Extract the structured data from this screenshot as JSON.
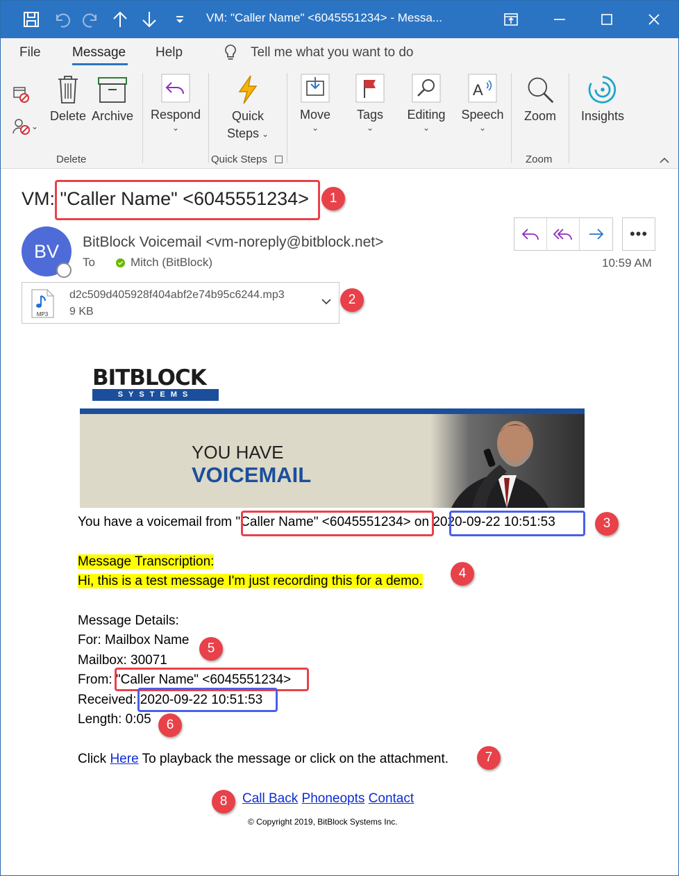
{
  "window": {
    "title": "VM: \"Caller Name\" <6045551234>  -  Messa...",
    "accent": "#2b74c3"
  },
  "tabs": [
    {
      "label": "File"
    },
    {
      "label": "Message"
    },
    {
      "label": "Help"
    }
  ],
  "tellme": {
    "label": "Tell me what you want to do"
  },
  "ribbon": {
    "delete_label": "Delete",
    "archive_label": "Archive",
    "delete_group": "Delete",
    "respond_label": "Respond",
    "quick_steps_line1": "Quick",
    "quick_steps_line2": "Steps",
    "quick_steps_group": "Quick Steps",
    "move_label": "Move",
    "tags_label": "Tags",
    "editing_label": "Editing",
    "speech_label": "Speech",
    "zoom_label": "Zoom",
    "zoom_group": "Zoom",
    "insights_label": "Insights"
  },
  "message": {
    "subject_prefix": "VM: ",
    "subject_caller": "\"Caller Name\" <6045551234>",
    "avatar_initials": "BV",
    "sender": "BitBlock Voicemail <vm-noreply@bitblock.net>",
    "to_label": "To",
    "recipient": "Mitch (BitBlock)",
    "time": "10:59 AM",
    "more_label": "•••"
  },
  "attachment": {
    "filename": "d2c509d405928f404abf2e74b95c6244.mp3",
    "size": "9 KB",
    "type_label": "MP3"
  },
  "body": {
    "logo_top": "BITBLOCK",
    "logo_bottom": "SYSTEMS",
    "banner_line1": "YOU HAVE",
    "banner_line2": "VOICEMAIL",
    "intro_prefix": "You have a voicemail from ",
    "intro_caller": "\"Caller Name\" <6045551234>",
    "intro_on": " on ",
    "intro_time": "2020-09-22 10:51:53",
    "transcription_title": "Message Transcription:",
    "transcription_text": "Hi, this is a test message I'm just recording this for a demo.",
    "details_title": "Message Details:",
    "for_line": "For: Mailbox Name",
    "mailbox_line": "Mailbox: 30071",
    "from_label": "From: ",
    "from_value": "\"Caller Name\" <6045551234>",
    "received_label": "Received: ",
    "received_value": "2020-09-22 10:51:53",
    "length_line": "Length: 0:05",
    "click_prefix": "Click ",
    "click_link": "Here",
    "click_suffix": " To playback the message or click on the attachment.",
    "link_callback": "Call Back",
    "link_phoneopts": "Phoneopts",
    "link_contact": "Contact",
    "copyright": "© Copyright 2019, BitBlock Systems Inc."
  },
  "annotations": [
    "1",
    "2",
    "3",
    "4",
    "5",
    "6",
    "7",
    "8"
  ],
  "colors": {
    "annotation_red": "#e8414a",
    "annotation_blue": "#4a5fe8",
    "highlight": "#ffff00",
    "link": "#0b2dd4"
  }
}
